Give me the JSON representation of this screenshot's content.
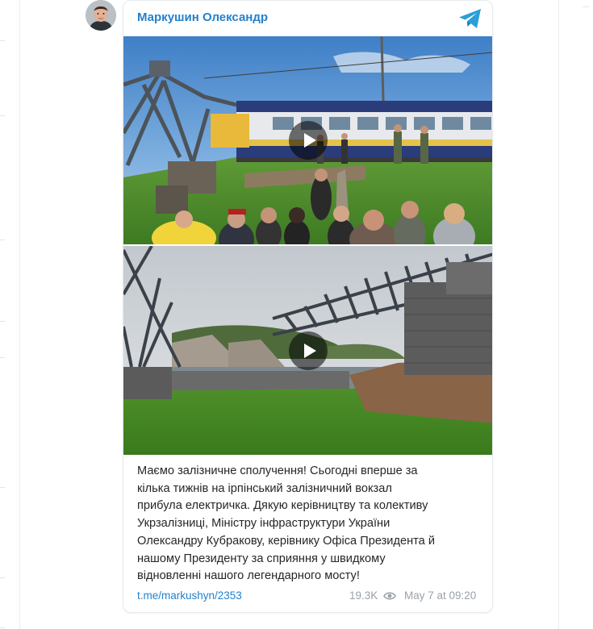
{
  "post": {
    "author": "Маркушин Олександр",
    "text": "Маємо залізничне сполучення! Сьогодні вперше за\nкілька тижнів на ірпінський залізничний вокзал\nприбула електричка. Дякую керівництву та колективу\nУкрзалізниці, Міністру інфраструктури України\nОлександру Кубракову, керівнику Офіса Президента й\nнашому Президенту за сприяння у швидкому\nвідновленні нашого легендарного мосту!",
    "link": "t.me/markushyn/2353",
    "views": "19.3K",
    "date": "May 7 at 09:20"
  },
  "media": [
    {
      "kind": "video",
      "icon": "play-icon"
    },
    {
      "kind": "video",
      "icon": "play-icon"
    }
  ],
  "icons": {
    "channel": "telegram-icon",
    "views": "eye-icon",
    "avatar": "avatar"
  },
  "colors": {
    "accent": "#2481cc",
    "meta": "#9aa1a8",
    "text": "#262626",
    "card_border": "#e7ebef"
  }
}
